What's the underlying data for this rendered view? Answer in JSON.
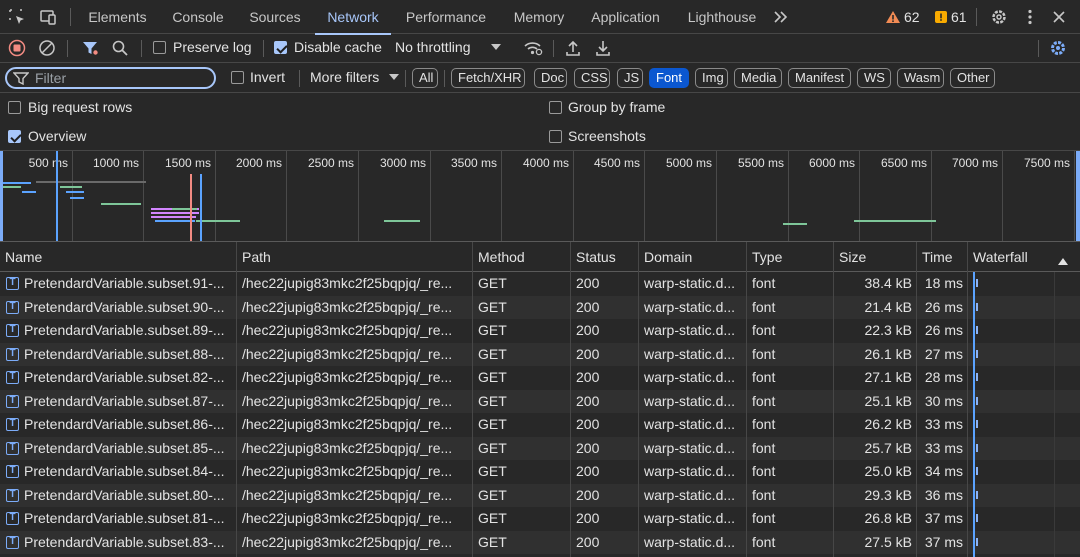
{
  "tabs": [
    {
      "label": "Elements",
      "active": false
    },
    {
      "label": "Console",
      "active": false
    },
    {
      "label": "Sources",
      "active": false
    },
    {
      "label": "Network",
      "active": true
    },
    {
      "label": "Performance",
      "active": false
    },
    {
      "label": "Memory",
      "active": false
    },
    {
      "label": "Application",
      "active": false
    },
    {
      "label": "Lighthouse",
      "active": false
    }
  ],
  "warnings_count": "62",
  "issues_count": "61",
  "toolbar": {
    "preserve_log": "Preserve log",
    "preserve_log_checked": false,
    "disable_cache": "Disable cache",
    "disable_cache_checked": true,
    "throttling": "No throttling"
  },
  "filterbar": {
    "filter_placeholder": "Filter",
    "invert": "Invert",
    "more_filters": "More filters",
    "types": [
      {
        "label": "All",
        "active": false
      },
      {
        "label": "Fetch/XHR",
        "active": false
      },
      {
        "label": "Doc",
        "active": false
      },
      {
        "label": "CSS",
        "active": false
      },
      {
        "label": "JS",
        "active": false
      },
      {
        "label": "Font",
        "active": true
      },
      {
        "label": "Img",
        "active": false
      },
      {
        "label": "Media",
        "active": false
      },
      {
        "label": "Manifest",
        "active": false
      },
      {
        "label": "WS",
        "active": false
      },
      {
        "label": "Wasm",
        "active": false
      },
      {
        "label": "Other",
        "active": false
      }
    ]
  },
  "options": {
    "big_request_rows": "Big request rows",
    "big_request_rows_checked": false,
    "overview": "Overview",
    "overview_checked": true,
    "group_by_frame": "Group by frame",
    "group_by_frame_checked": false,
    "screenshots": "Screenshots",
    "screenshots_checked": false
  },
  "overview_ticks": [
    "500 ms",
    "1000 ms",
    "1500 ms",
    "2000 ms",
    "2500 ms",
    "3000 ms",
    "3500 ms",
    "4000 ms",
    "4500 ms",
    "5000 ms",
    "5500 ms",
    "6000 ms",
    "6500 ms",
    "7000 ms",
    "7500 ms"
  ],
  "columns": [
    "Name",
    "Path",
    "Method",
    "Status",
    "Domain",
    "Type",
    "Size",
    "Time",
    "Waterfall"
  ],
  "rows": [
    {
      "name": "PretendardVariable.subset.91-...",
      "path": "/hec22jupig83mkc2f25bqpjq/_re...",
      "method": "GET",
      "status": "200",
      "domain": "warp-static.d...",
      "type": "font",
      "size": "38.4 kB",
      "time": "18 ms"
    },
    {
      "name": "PretendardVariable.subset.90-...",
      "path": "/hec22jupig83mkc2f25bqpjq/_re...",
      "method": "GET",
      "status": "200",
      "domain": "warp-static.d...",
      "type": "font",
      "size": "21.4 kB",
      "time": "26 ms"
    },
    {
      "name": "PretendardVariable.subset.89-...",
      "path": "/hec22jupig83mkc2f25bqpjq/_re...",
      "method": "GET",
      "status": "200",
      "domain": "warp-static.d...",
      "type": "font",
      "size": "22.3 kB",
      "time": "26 ms"
    },
    {
      "name": "PretendardVariable.subset.88-...",
      "path": "/hec22jupig83mkc2f25bqpjq/_re...",
      "method": "GET",
      "status": "200",
      "domain": "warp-static.d...",
      "type": "font",
      "size": "26.1 kB",
      "time": "27 ms"
    },
    {
      "name": "PretendardVariable.subset.82-...",
      "path": "/hec22jupig83mkc2f25bqpjq/_re...",
      "method": "GET",
      "status": "200",
      "domain": "warp-static.d...",
      "type": "font",
      "size": "27.1 kB",
      "time": "28 ms"
    },
    {
      "name": "PretendardVariable.subset.87-...",
      "path": "/hec22jupig83mkc2f25bqpjq/_re...",
      "method": "GET",
      "status": "200",
      "domain": "warp-static.d...",
      "type": "font",
      "size": "25.1 kB",
      "time": "30 ms"
    },
    {
      "name": "PretendardVariable.subset.86-...",
      "path": "/hec22jupig83mkc2f25bqpjq/_re...",
      "method": "GET",
      "status": "200",
      "domain": "warp-static.d...",
      "type": "font",
      "size": "26.2 kB",
      "time": "33 ms"
    },
    {
      "name": "PretendardVariable.subset.85-...",
      "path": "/hec22jupig83mkc2f25bqpjq/_re...",
      "method": "GET",
      "status": "200",
      "domain": "warp-static.d...",
      "type": "font",
      "size": "25.7 kB",
      "time": "33 ms"
    },
    {
      "name": "PretendardVariable.subset.84-...",
      "path": "/hec22jupig83mkc2f25bqpjq/_re...",
      "method": "GET",
      "status": "200",
      "domain": "warp-static.d...",
      "type": "font",
      "size": "25.0 kB",
      "time": "34 ms"
    },
    {
      "name": "PretendardVariable.subset.80-...",
      "path": "/hec22jupig83mkc2f25bqpjq/_re...",
      "method": "GET",
      "status": "200",
      "domain": "warp-static.d...",
      "type": "font",
      "size": "29.3 kB",
      "time": "36 ms"
    },
    {
      "name": "PretendardVariable.subset.81-...",
      "path": "/hec22jupig83mkc2f25bqpjq/_re...",
      "method": "GET",
      "status": "200",
      "domain": "warp-static.d...",
      "type": "font",
      "size": "26.8 kB",
      "time": "37 ms"
    },
    {
      "name": "PretendardVariable.subset.83-...",
      "path": "/hec22jupig83mkc2f25bqpjq/_re...",
      "method": "GET",
      "status": "200",
      "domain": "warp-static.d...",
      "type": "font",
      "size": "27.5 kB",
      "time": "37 ms"
    }
  ],
  "colors": {
    "accent": "#a8c7fa",
    "active_pill": "#0b57d0",
    "warning": "#f28b54",
    "issue": "#f9ab00",
    "record": "#f28b82",
    "settings": "#7cacf8"
  }
}
